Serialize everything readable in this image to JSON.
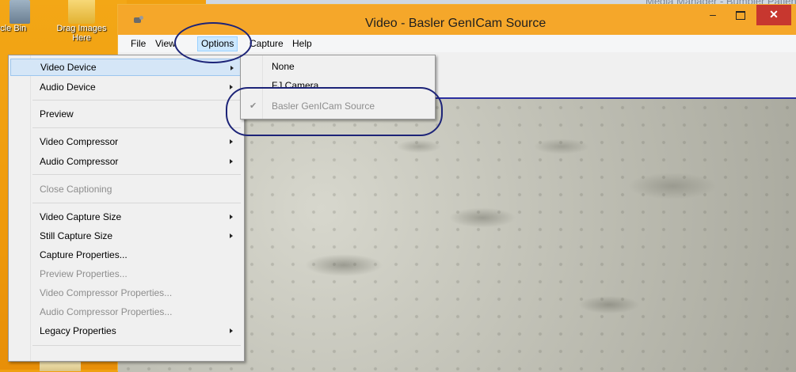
{
  "desktop": {
    "icons": [
      {
        "label": "ycle Bin",
        "icon": "recycle-bin-icon"
      },
      {
        "label": "Drag Images Here",
        "icon": "folder-icon"
      }
    ]
  },
  "background_window": {
    "title_fragment": "Media Manager - Bumbler Patient"
  },
  "window": {
    "title": "Video - Basler GenICam Source",
    "controls": {
      "minimize": "–",
      "maximize": "",
      "close": "✕"
    }
  },
  "menubar": {
    "items": [
      "File",
      "View",
      "Options",
      "Capture",
      "Help"
    ]
  },
  "options_menu": {
    "items": [
      {
        "label": "Video Device",
        "submenu": true,
        "highlighted": true
      },
      {
        "label": "Audio Device",
        "submenu": true
      },
      {
        "label": "Preview"
      },
      {
        "label": "Video Compressor",
        "submenu": true
      },
      {
        "label": "Audio Compressor",
        "submenu": true
      },
      {
        "label": "Close Captioning",
        "disabled": true
      },
      {
        "label": "Video Capture Size",
        "submenu": true
      },
      {
        "label": "Still Capture Size",
        "submenu": true
      },
      {
        "label": "Capture Properties..."
      },
      {
        "label": "Preview Properties...",
        "disabled": true
      },
      {
        "label": "Video Compressor Properties...",
        "disabled": true
      },
      {
        "label": "Audio Compressor Properties...",
        "disabled": true
      },
      {
        "label": "Legacy Properties",
        "submenu": true
      }
    ]
  },
  "video_device_submenu": {
    "items": [
      {
        "label": "None"
      },
      {
        "label": "FJ Camera"
      },
      {
        "label": "Basler GenICam Source",
        "checked": true,
        "disabled": true
      }
    ],
    "check_glyph": "✔"
  },
  "colors": {
    "titlebar": "#f5a72a",
    "desktop": "#f0a010",
    "annotation": "#1d2478",
    "highlight": "#d5e6f7"
  }
}
